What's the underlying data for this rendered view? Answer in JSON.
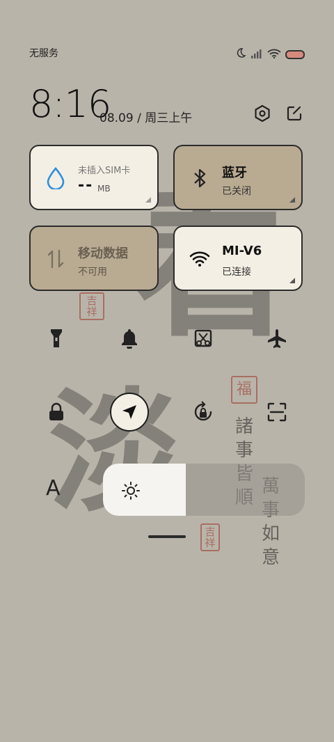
{
  "status_bar": {
    "carrier": "无服务",
    "icons": [
      "moon-icon",
      "signal-icon",
      "wifi-icon",
      "battery-icon"
    ]
  },
  "header": {
    "time": "8:16",
    "date": "08.09 / 周三上午",
    "settings_icon": "settings-hexagon-icon",
    "edit_icon": "edit-icon"
  },
  "cards": {
    "data_usage": {
      "title": "未插入SIM卡",
      "value": "--",
      "unit": "MB",
      "icon": "drop-icon"
    },
    "bluetooth": {
      "title": "蓝牙",
      "status": "已关闭",
      "icon": "bluetooth-icon"
    },
    "mobile_data": {
      "title": "移动数据",
      "status": "不可用",
      "icon": "data-arrows-icon"
    },
    "wifi": {
      "title": "MI-V6",
      "status": "已连接",
      "icon": "wifi-icon"
    }
  },
  "toggles_row1": [
    "flashlight-icon",
    "bell-icon",
    "screenshot-icon",
    "airplane-icon"
  ],
  "toggles_row2": [
    "lock-icon",
    "location-icon",
    "rotation-lock-icon",
    "scan-icon"
  ],
  "brightness": {
    "level_fraction": 0.41,
    "auto_label": "A"
  },
  "wallpaper": {
    "big_chars": [
      "看",
      "淡"
    ],
    "vertical_text_1": "諸事皆順",
    "vertical_text_2": "萬事如意",
    "seal_1": "吉祥",
    "seal_2": "福",
    "seal_3": "吉祥"
  },
  "colors": {
    "background": "#b9b4aa",
    "card_light": "#f4efe5",
    "card_tan": "#b9ab92",
    "accent_blue": "#2d8fe0"
  }
}
